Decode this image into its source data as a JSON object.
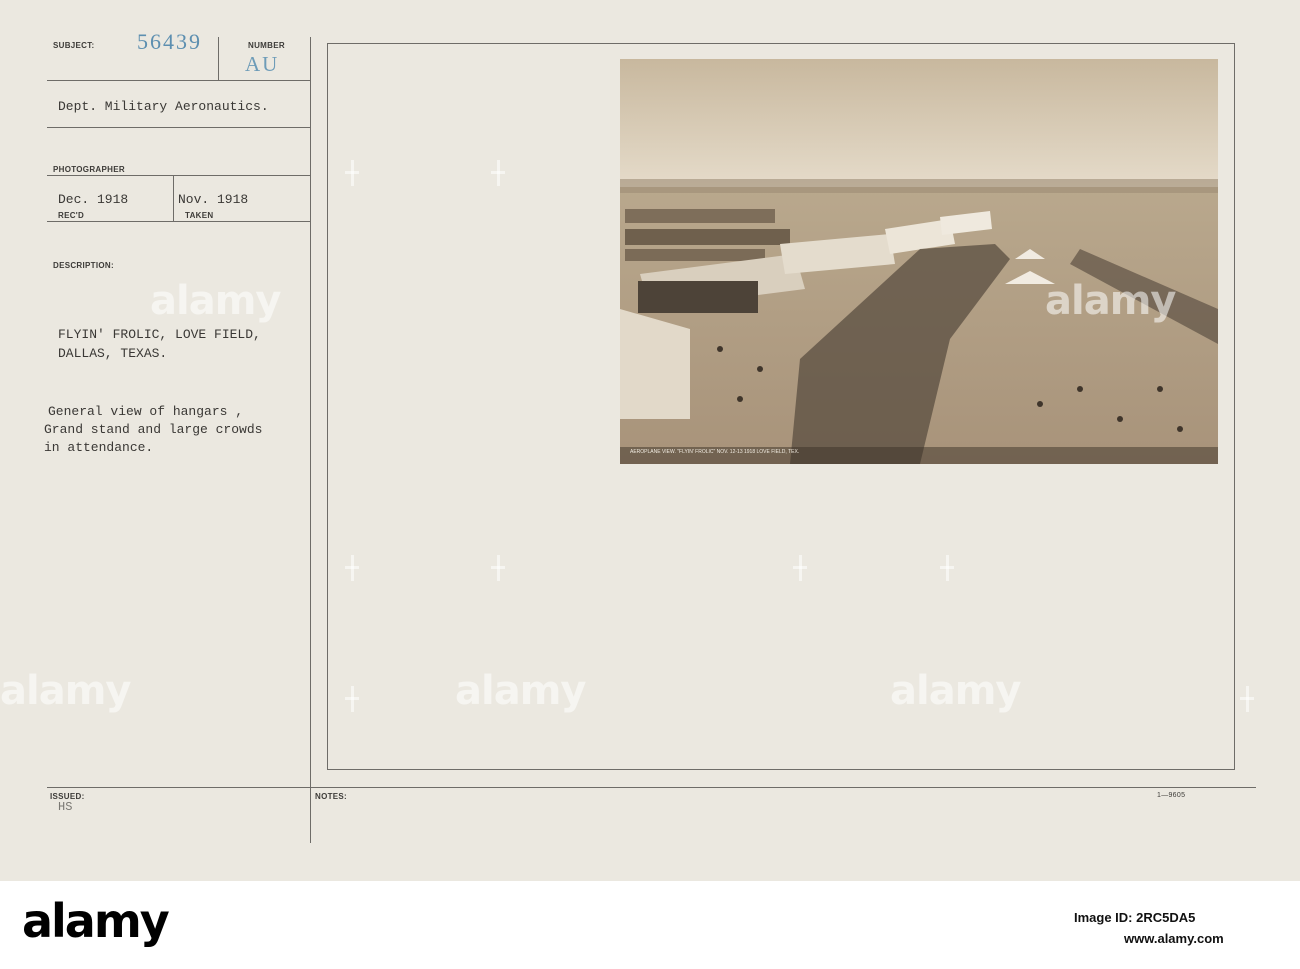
{
  "record": {
    "subject_label": "SUBJECT:",
    "subject_number": "56439",
    "number_label": "NUMBER",
    "number_value": "AU",
    "department": "Dept. Military Aeronautics.",
    "photographer_label": "PHOTOGRAPHER",
    "received_date": "Dec. 1918",
    "received_label": "REC'D",
    "taken_date": "Nov. 1918",
    "taken_label": "TAKEN",
    "description_label": "DESCRIPTION:",
    "description_title_line1": "FLYIN' FROLIC, LOVE FIELD,",
    "description_title_line2": "DALLAS, TEXAS.",
    "description_body_line1": "General view of hangars ,",
    "description_body_line2": "Grand stand and large crowds",
    "description_body_line3": "in attendance.",
    "issued_label": "ISSUED:",
    "issued_value": "HS",
    "notes_label": "NOTES:",
    "form_code": "1—9605"
  },
  "photo": {
    "caption": "AEROPLANE VIEW. \"FLYIN' FROLIC\" NOV. 12-13 1918 LOVE FIELD, TEX."
  },
  "watermark": {
    "brand": "alamy"
  },
  "footer": {
    "logo": "alamy",
    "image_id": "Image ID: 2RC5DA5",
    "site": "www.alamy.com"
  },
  "colors": {
    "card": "#ebe8e0",
    "stamp": "#6e9cb8",
    "photo_sepia": "#d4c6ae"
  }
}
